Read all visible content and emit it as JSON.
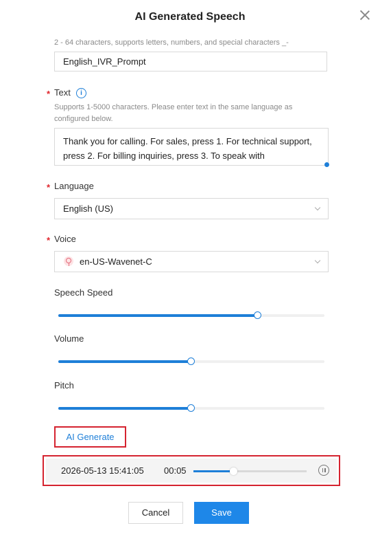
{
  "dialog": {
    "title": "AI Generated Speech"
  },
  "name_field": {
    "hint": "2 - 64 characters, supports letters, numbers, and special characters _-",
    "value": "English_IVR_Prompt"
  },
  "text_field": {
    "label": "Text",
    "required_mark": "*",
    "hint": "Supports 1-5000 characters. Please enter text in the same language as configured below.",
    "value": "Thank you for calling. For sales, press 1. For technical support, press 2. For billing inquiries, press 3. To speak with"
  },
  "language_field": {
    "label": "Language",
    "required_mark": "*",
    "value": "English (US)"
  },
  "voice_field": {
    "label": "Voice",
    "required_mark": "*",
    "value": "en-US-Wavenet-C",
    "icon": "female-icon"
  },
  "sliders": {
    "speech_speed": {
      "label": "Speech Speed",
      "level": 0.75
    },
    "volume": {
      "label": "Volume",
      "level": 0.5
    },
    "pitch": {
      "label": "Pitch",
      "level": 0.5
    }
  },
  "ai_generate_label": "AI Generate",
  "player": {
    "timestamp": "2026-05-13 15:41:05",
    "elapsed": "00:05",
    "progress": 0.35,
    "control_icon": "pause-icon"
  },
  "footer": {
    "cancel_label": "Cancel",
    "save_label": "Save"
  },
  "colors": {
    "accent": "#1e7fd8",
    "highlight_border": "#d5232f",
    "required": "#e0262d"
  }
}
